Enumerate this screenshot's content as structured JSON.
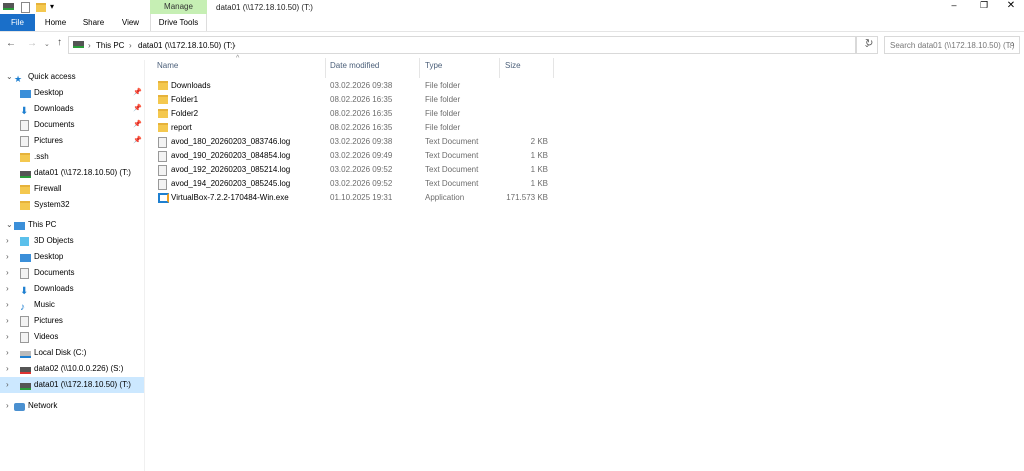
{
  "window": {
    "title": "data01 (\\\\172.18.10.50) (T:)",
    "context_group": "Manage"
  },
  "ribbon": {
    "tabs": [
      "File",
      "Home",
      "Share",
      "View",
      "Drive Tools"
    ]
  },
  "address": {
    "segments": [
      "This PC",
      "data01 (\\\\172.18.10.50) (T:)"
    ],
    "search_placeholder": "Search data01 (\\\\172.18.10.50) (T:)"
  },
  "columns": {
    "name": "Name",
    "date": "Date modified",
    "type": "Type",
    "size": "Size"
  },
  "files": [
    {
      "name": "Downloads",
      "date": "03.02.2026 09:38",
      "type": "File folder",
      "size": "",
      "icon": "folder"
    },
    {
      "name": "Folder1",
      "date": "08.02.2026 16:35",
      "type": "File folder",
      "size": "",
      "icon": "folder"
    },
    {
      "name": "Folder2",
      "date": "08.02.2026 16:35",
      "type": "File folder",
      "size": "",
      "icon": "folder"
    },
    {
      "name": "report",
      "date": "08.02.2026 16:35",
      "type": "File folder",
      "size": "",
      "icon": "folder"
    },
    {
      "name": "avod_180_20260203_083746.log",
      "date": "03.02.2026 09:38",
      "type": "Text Document",
      "size": "2 KB",
      "icon": "doc"
    },
    {
      "name": "avod_190_20260203_084854.log",
      "date": "03.02.2026 09:49",
      "type": "Text Document",
      "size": "1 KB",
      "icon": "doc"
    },
    {
      "name": "avod_192_20260203_085214.log",
      "date": "03.02.2026 09:52",
      "type": "Text Document",
      "size": "1 KB",
      "icon": "doc"
    },
    {
      "name": "avod_194_20260203_085245.log",
      "date": "03.02.2026 09:52",
      "type": "Text Document",
      "size": "1 KB",
      "icon": "doc"
    },
    {
      "name": "VirtualBox-7.2.2-170484-Win.exe",
      "date": "01.10.2025 19:31",
      "type": "Application",
      "size": "171.573 KB",
      "icon": "app"
    }
  ],
  "nav": {
    "quick_access": "Quick access",
    "quick_items": [
      "Desktop",
      "Downloads",
      "Documents",
      "Pictures",
      ".ssh",
      "data01 (\\\\172.18.10.50) (T:)",
      "Firewall",
      "System32"
    ],
    "this_pc": "This PC",
    "pc_items": [
      "3D Objects",
      "Desktop",
      "Documents",
      "Downloads",
      "Music",
      "Pictures",
      "Videos",
      "Local Disk (C:)",
      "data02 (\\\\10.0.0.226) (S:)",
      "data01 (\\\\172.18.10.50) (T:)"
    ],
    "network": "Network"
  },
  "colors": {
    "accent": "#1a6fc9",
    "manage": "#c6efb4",
    "selected": "#cce8ff"
  }
}
